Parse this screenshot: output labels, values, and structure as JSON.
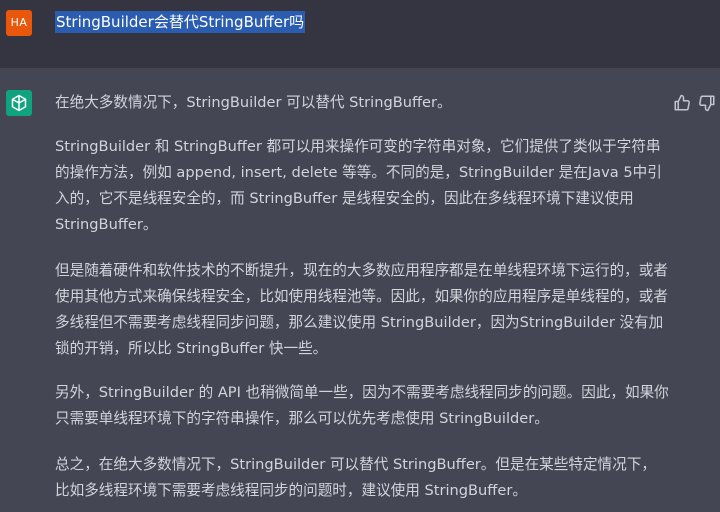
{
  "user_message": {
    "avatar_initials": "HA",
    "text": "StringBuilder会替代StringBuffer吗"
  },
  "assistant_message": {
    "avatar_icon": "openai-logo-icon",
    "feedback_icons": [
      "thumbs-up-icon",
      "thumbs-down-icon"
    ],
    "paragraphs": [
      "在绝大多数情况下，StringBuilder 可以替代 StringBuffer。",
      "StringBuilder 和 StringBuffer 都可以用来操作可变的字符串对象，它们提供了类似于字符串的操作方法，例如 append, insert, delete 等等。不同的是，StringBuilder 是在Java 5中引入的，它不是线程安全的，而 StringBuffer 是线程安全的，因此在多线程环境下建议使用StringBuffer。",
      "但是随着硬件和软件技术的不断提升，现在的大多数应用程序都是在单线程环境下运行的，或者使用其他方式来确保线程安全，比如使用线程池等。因此，如果你的应用程序是单线程的，或者多线程但不需要考虑线程同步问题，那么建议使用 StringBuilder，因为StringBuilder 没有加锁的开销，所以比 StringBuffer 快一些。",
      "另外，StringBuilder 的 API 也稍微简单一些，因为不需要考虑线程同步的问题。因此，如果你只需要单线程环境下的字符串操作，那么可以优先考虑使用 StringBuilder。",
      "总之，在绝大多数情况下，StringBuilder 可以替代 StringBuffer。但是在某些特定情况下，比如多线程环境下需要考虑线程同步的问题时，建议使用 StringBuffer。"
    ]
  },
  "colors": {
    "user_row_bg": "#343541",
    "assistant_row_bg": "#444654",
    "user_avatar_bg": "#e8570c",
    "bot_avatar_bg": "#10a37f",
    "text": "#d1d5db",
    "selection_highlight": "#2a5db0"
  }
}
